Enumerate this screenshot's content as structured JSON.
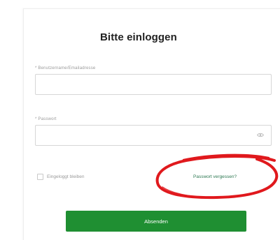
{
  "login": {
    "title": "Bitte einloggen",
    "username_label": "* Benutzername/Emailadresse",
    "username_value": "",
    "password_label": "* Passwort",
    "password_value": "",
    "remember_label": "Eingeloggt bleiben",
    "remember_checked": false,
    "forgot_link": "Passwort vergessen?",
    "submit_label": "Absenden"
  },
  "icons": {
    "password_toggle": "eye-icon",
    "checkbox": "checkbox-icon",
    "annotation": "red-circle-annotation"
  },
  "colors": {
    "submit_button": "#1f8f32",
    "link": "#2f7a54",
    "annotation": "#e0191d"
  }
}
